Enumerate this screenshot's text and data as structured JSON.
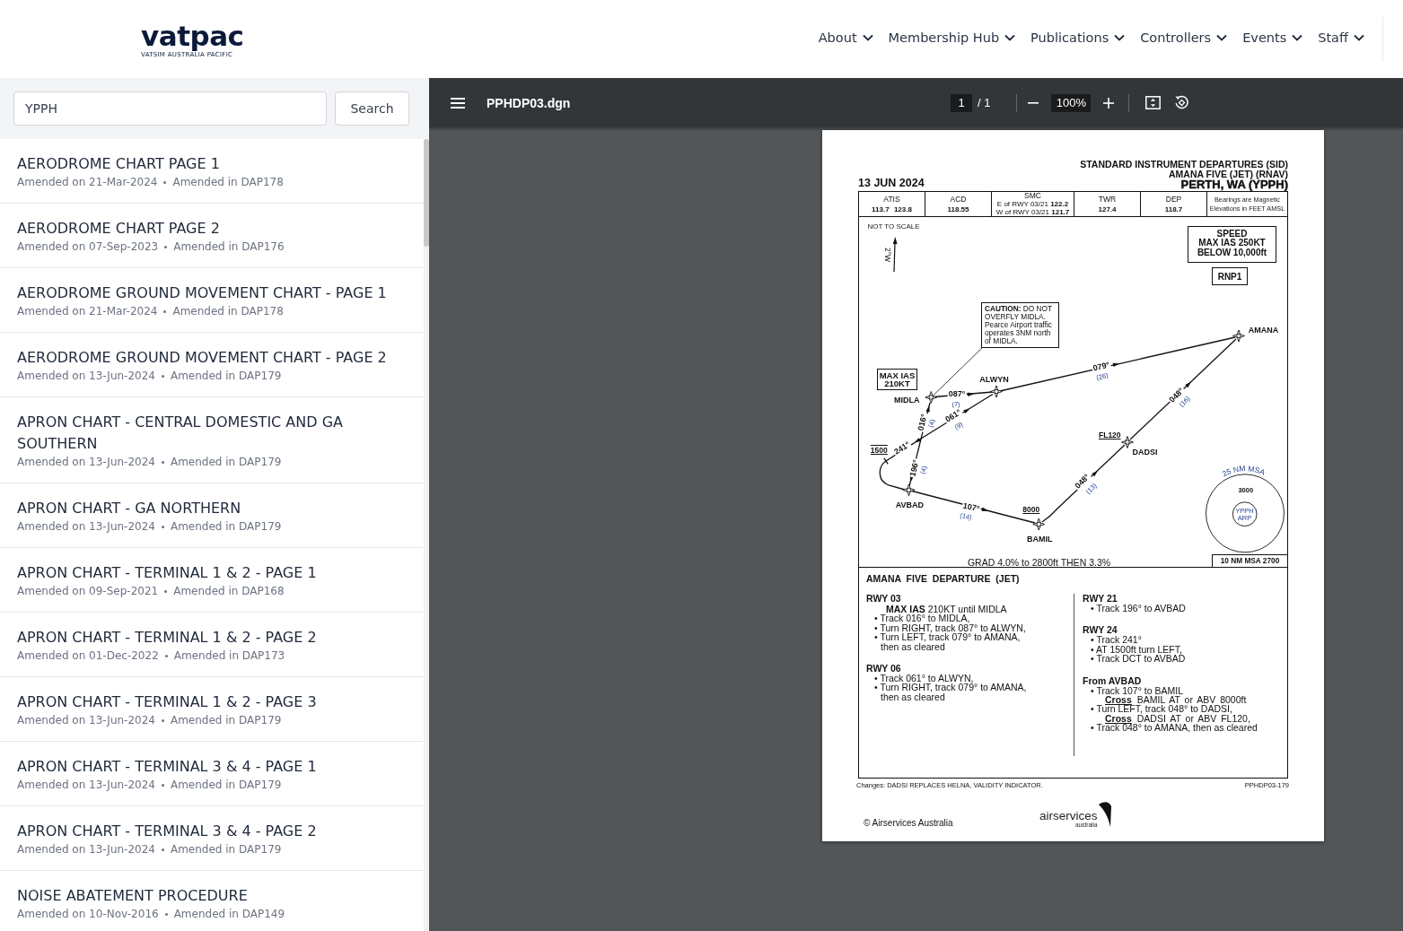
{
  "header": {
    "logo": {
      "wordmark": "vatpac",
      "tagline": "VATSIM AUSTRALIA PACIFIC"
    },
    "nav": [
      {
        "label": "About"
      },
      {
        "label": "Membership Hub"
      },
      {
        "label": "Publications"
      },
      {
        "label": "Controllers"
      },
      {
        "label": "Events"
      },
      {
        "label": "Staff"
      }
    ]
  },
  "sidebar": {
    "search": {
      "value": "YPPH",
      "button": "Search"
    },
    "documents": [
      {
        "title": "AERODROME CHART PAGE 1",
        "amended_on": "Amended on 21-Mar-2024",
        "amended_in": "Amended in DAP178",
        "selected": false
      },
      {
        "title": "AERODROME CHART PAGE 2",
        "amended_on": "Amended on 07-Sep-2023",
        "amended_in": "Amended in DAP176",
        "selected": false
      },
      {
        "title": "AERODROME GROUND MOVEMENT CHART - PAGE 1",
        "amended_on": "Amended on 21-Mar-2024",
        "amended_in": "Amended in DAP178",
        "selected": false
      },
      {
        "title": "AERODROME GROUND MOVEMENT CHART - PAGE 2",
        "amended_on": "Amended on 13-Jun-2024",
        "amended_in": "Amended in DAP179",
        "selected": false
      },
      {
        "title": "APRON CHART - CENTRAL DOMESTIC AND GA SOUTHERN",
        "amended_on": "Amended on 13-Jun-2024",
        "amended_in": "Amended in DAP179",
        "selected": false
      },
      {
        "title": "APRON CHART - GA NORTHERN",
        "amended_on": "Amended on 13-Jun-2024",
        "amended_in": "Amended in DAP179",
        "selected": false
      },
      {
        "title": "APRON CHART - TERMINAL 1 & 2 - PAGE 1",
        "amended_on": "Amended on 09-Sep-2021",
        "amended_in": "Amended in DAP168",
        "selected": false
      },
      {
        "title": "APRON CHART - TERMINAL 1 & 2 - PAGE 2",
        "amended_on": "Amended on 01-Dec-2022",
        "amended_in": "Amended in DAP173",
        "selected": false
      },
      {
        "title": "APRON CHART - TERMINAL 1 & 2 - PAGE 3",
        "amended_on": "Amended on 13-Jun-2024",
        "amended_in": "Amended in DAP179",
        "selected": false
      },
      {
        "title": "APRON CHART - TERMINAL 3 & 4 - PAGE 1",
        "amended_on": "Amended on 13-Jun-2024",
        "amended_in": "Amended in DAP179",
        "selected": false
      },
      {
        "title": "APRON CHART - TERMINAL 3 & 4 - PAGE 2",
        "amended_on": "Amended on 13-Jun-2024",
        "amended_in": "Amended in DAP179",
        "selected": false
      },
      {
        "title": "NOISE ABATEMENT PROCEDURE",
        "amended_on": "Amended on 10-Nov-2016",
        "amended_in": "Amended in DAP149",
        "selected": false
      }
    ]
  },
  "viewer": {
    "toolbar": {
      "file_name": "PPHDP03.dgn",
      "page": "1",
      "page_count": "/ 1",
      "zoom": "100%"
    },
    "document": {
      "date": "13 JUN 2024",
      "title": {
        "heading": "STANDARD INSTRUMENT DEPARTURES (SID)",
        "procedure": "AMANA FIVE (JET) (RNAV)",
        "airport": "PERTH, WA (YPPH)"
      },
      "frequencies": [
        {
          "kind": "single",
          "label": "ATIS",
          "value": "113.7 123.8"
        },
        {
          "kind": "single",
          "label": "ACD",
          "value": "118.55"
        },
        {
          "kind": "split",
          "label": "SMC",
          "lines": [
            "E of RWY 03/21 **122.2**",
            "W of RWY 03/21 **121.7**"
          ]
        },
        {
          "kind": "single",
          "label": "TWR",
          "value": "127.4"
        },
        {
          "kind": "single",
          "label": "DEP",
          "value": "118.7"
        }
      ],
      "notes": [
        "Bearings are Magnetic",
        "Elevations in FEET AMSL"
      ],
      "map": {
        "scale_note": "NOT TO SCALE",
        "variation": "2°W",
        "speed_limit": [
          "SPEED",
          "MAX IAS 250KT",
          "BELOW 10,000ft"
        ],
        "nav_spec": "RNP1",
        "caution": [
          "**CAUTION:** DO NOT",
          "OVERFLY MIDLA.",
          "Pearce Airport traffic",
          "operates 3NM north",
          "of MIDLA."
        ],
        "speed_restriction": [
          "MAX IAS",
          "210KT"
        ],
        "waypoints": [
          {
            "name": "MIDLA"
          },
          {
            "name": "ALWYN"
          },
          {
            "name": "AMANA"
          },
          {
            "name": "DADSI",
            "constraint": "FL120"
          },
          {
            "name": "BAMIL",
            "constraint": "8000"
          },
          {
            "name": "AVBAD"
          }
        ],
        "turn_altitude": "1500",
        "legs": [
          {
            "bearing": "087°",
            "distance": "(7)"
          },
          {
            "bearing": "061°",
            "distance": "(9)"
          },
          {
            "bearing": "016°",
            "distance": "(4)"
          },
          {
            "bearing": "241°"
          },
          {
            "bearing": "196°",
            "distance": "(4)"
          },
          {
            "bearing": "107°",
            "distance": "(14)"
          },
          {
            "bearing": "079°",
            "distance": "(26)"
          },
          {
            "bearing": "048°",
            "distance": "(13)"
          },
          {
            "bearing": "048°",
            "distance": "(16)"
          }
        ],
        "msa": {
          "label": "25 NM MSA",
          "altitude": "3000",
          "reference": [
            "YPPH",
            "ARP"
          ]
        },
        "gradient": "GRAD 4.0% to 2800ft THEN 3.3%",
        "inner_msa": "10 NM MSA 2700"
      },
      "procedure": {
        "title": "AMANA FIVE DEPARTURE (JET)",
        "columns": [
          [
            {
              "heading": "RWY 03",
              "items": [
                {
                  "kind": "note",
                  "text": "**MAX IAS** 210KT until MIDLA"
                },
                {
                  "kind": "bullet",
                  "text": "• Track 016° to MIDLA,"
                },
                {
                  "kind": "bullet",
                  "text": "• Turn RIGHT, track 087° to ALWYN,"
                },
                {
                  "kind": "bullet",
                  "text": "• Turn LEFT, track 079° to AMANA, then as cleared"
                }
              ]
            },
            {
              "heading": "RWY 06",
              "items": [
                {
                  "kind": "bullet",
                  "text": "• Track 061° to ALWYN,"
                },
                {
                  "kind": "bullet",
                  "text": "• Turn RIGHT, track 079° to AMANA, then as cleared"
                }
              ]
            }
          ],
          [
            {
              "heading": "RWY 21",
              "items": [
                {
                  "kind": "bullet",
                  "text": "• Track 196° to AVBAD"
                }
              ]
            },
            {
              "heading": "RWY 24",
              "items": [
                {
                  "kind": "bullet",
                  "text": "• Track 241°"
                },
                {
                  "kind": "bullet",
                  "text": "• AT 1500ft turn LEFT,"
                },
                {
                  "kind": "bullet",
                  "text": "• Track DCT to AVBAD"
                }
              ]
            },
            {
              "heading": "From AVBAD",
              "items": [
                {
                  "kind": "bullet",
                  "text": "• Track 107° to BAMIL"
                },
                {
                  "kind": "constraint",
                  "keyword": "Cross",
                  "text": "BAMIL AT or ABV 8000ft"
                },
                {
                  "kind": "bullet",
                  "text": "• Turn LEFT, track 048° to DADSI,"
                },
                {
                  "kind": "constraint",
                  "keyword": "Cross",
                  "text": "DADSI AT or ABV FL120,"
                },
                {
                  "kind": "bullet",
                  "text": "• Track 048° to AMANA, then as cleared"
                }
              ]
            }
          ]
        ]
      },
      "changes": "Changes: DADSI REPLACES HELNA, VALIDITY INDICATOR.",
      "code": "PPHDP03-179",
      "copyright": "© Airservices Australia",
      "publisher": {
        "name": "airservices",
        "region": "australia"
      }
    }
  }
}
